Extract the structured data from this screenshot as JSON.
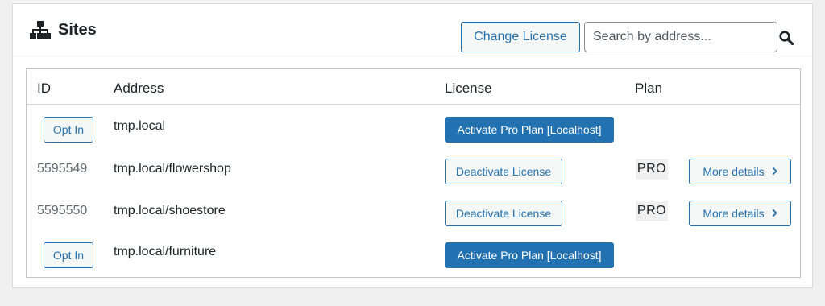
{
  "header": {
    "title": "Sites",
    "icon": "sitemap-icon",
    "change_license_label": "Change License",
    "search": {
      "placeholder": "Search by address...",
      "value": ""
    }
  },
  "table": {
    "columns": [
      "ID",
      "Address",
      "License",
      "Plan"
    ],
    "rows": [
      {
        "id": "",
        "opt_in_label": "Opt In",
        "address": "tmp.local",
        "license_action": "Activate Pro Plan [Localhost]",
        "plan": "",
        "details_label": ""
      },
      {
        "id": "5595549",
        "opt_in_label": "",
        "address": "tmp.local/flowershop",
        "license_action": "Deactivate License",
        "plan": "PRO",
        "details_label": "More details"
      },
      {
        "id": "5595550",
        "opt_in_label": "",
        "address": "tmp.local/shoestore",
        "license_action": "Deactivate License",
        "plan": "PRO",
        "details_label": "More details"
      },
      {
        "id": "",
        "opt_in_label": "Opt In",
        "address": "tmp.local/furniture",
        "license_action": "Activate Pro Plan [Localhost]",
        "plan": "",
        "details_label": ""
      }
    ]
  },
  "colors": {
    "primary": "#2271b1",
    "background": "#f0f0f1",
    "text": "#1d2327",
    "muted": "#646970"
  }
}
